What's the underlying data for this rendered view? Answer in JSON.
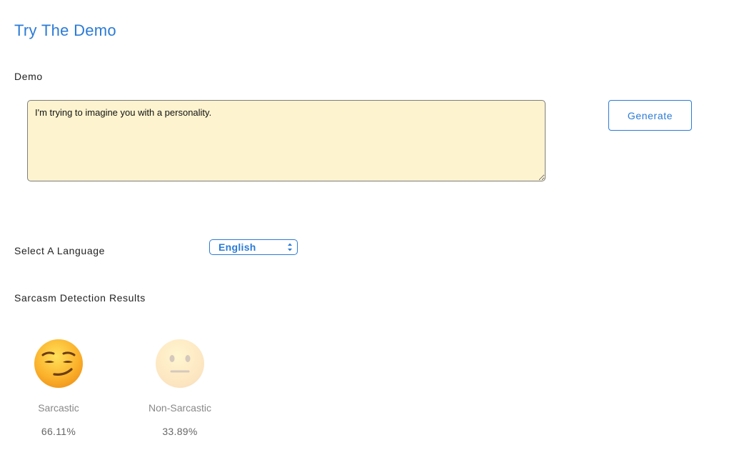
{
  "page": {
    "title": "Try The Demo"
  },
  "demo": {
    "label": "Demo",
    "text": "I'm trying to imagine you with a personality.",
    "generate_label": "Generate"
  },
  "language": {
    "label": "Select A Language",
    "selected": "English"
  },
  "results": {
    "heading": "Sarcasm Detection Results",
    "items": [
      {
        "label": "Sarcastic",
        "value": "66.11%",
        "icon": "smirking-face-icon"
      },
      {
        "label": "Non-Sarcastic",
        "value": "33.89%",
        "icon": "neutral-face-icon"
      }
    ]
  },
  "colors": {
    "accent": "#2b7bd6",
    "textarea_bg": "#fdf3cf"
  }
}
